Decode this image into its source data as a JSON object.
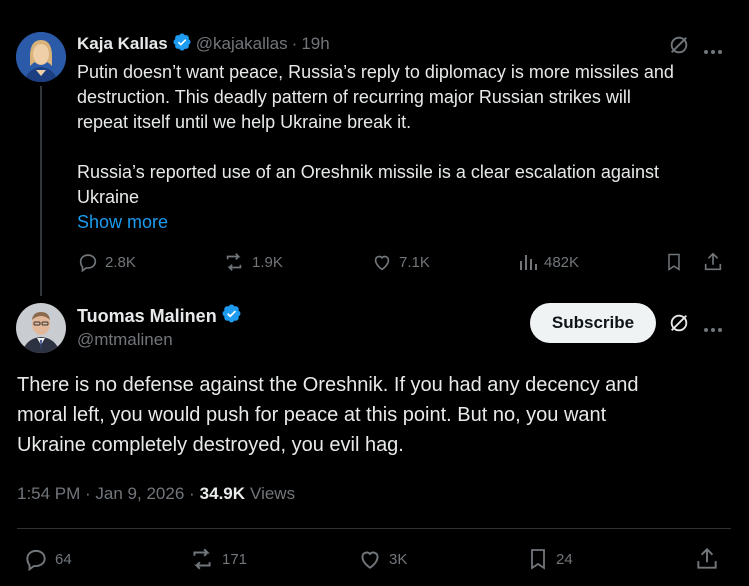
{
  "parent_tweet": {
    "author_name": "Kaja Kallas",
    "handle": "@kajakallas",
    "separator": "·",
    "time": "19h",
    "text_lines": [
      "Putin doesn’t want peace, Russia’s reply to diplomacy is more missiles and",
      "destruction. This deadly pattern of recurring major Russian strikes will",
      "repeat itself until we help Ukraine break it.",
      "Russia’s reported use of an Oreshnik missile is a clear escalation against",
      "Ukraine"
    ],
    "show_more": "Show more",
    "replies": "2.8K",
    "reposts": "1.9K",
    "likes": "7.1K",
    "views": "482K"
  },
  "main_tweet": {
    "author_name": "Tuomas Malinen",
    "handle": "@mtmalinen",
    "subscribe_label": "Subscribe",
    "text_lines": [
      "There is no defense against the Oreshnik. If you had any decency and",
      "moral left, you would push for peace at this point. But no, you want",
      "Ukraine completely destroyed, you evil hag."
    ],
    "timestamp": "1:54 PM · Jan 9, 2026 ·",
    "view_count": "34.9K",
    "views_label": "Views",
    "replies": "64",
    "reposts": "171",
    "likes": "3K",
    "bookmarks": "24"
  },
  "colors": {
    "background": "#000000",
    "text": "#e7e9ea",
    "muted": "#71767b",
    "link": "#1d9bf0",
    "verified": "#1d9bf0"
  }
}
